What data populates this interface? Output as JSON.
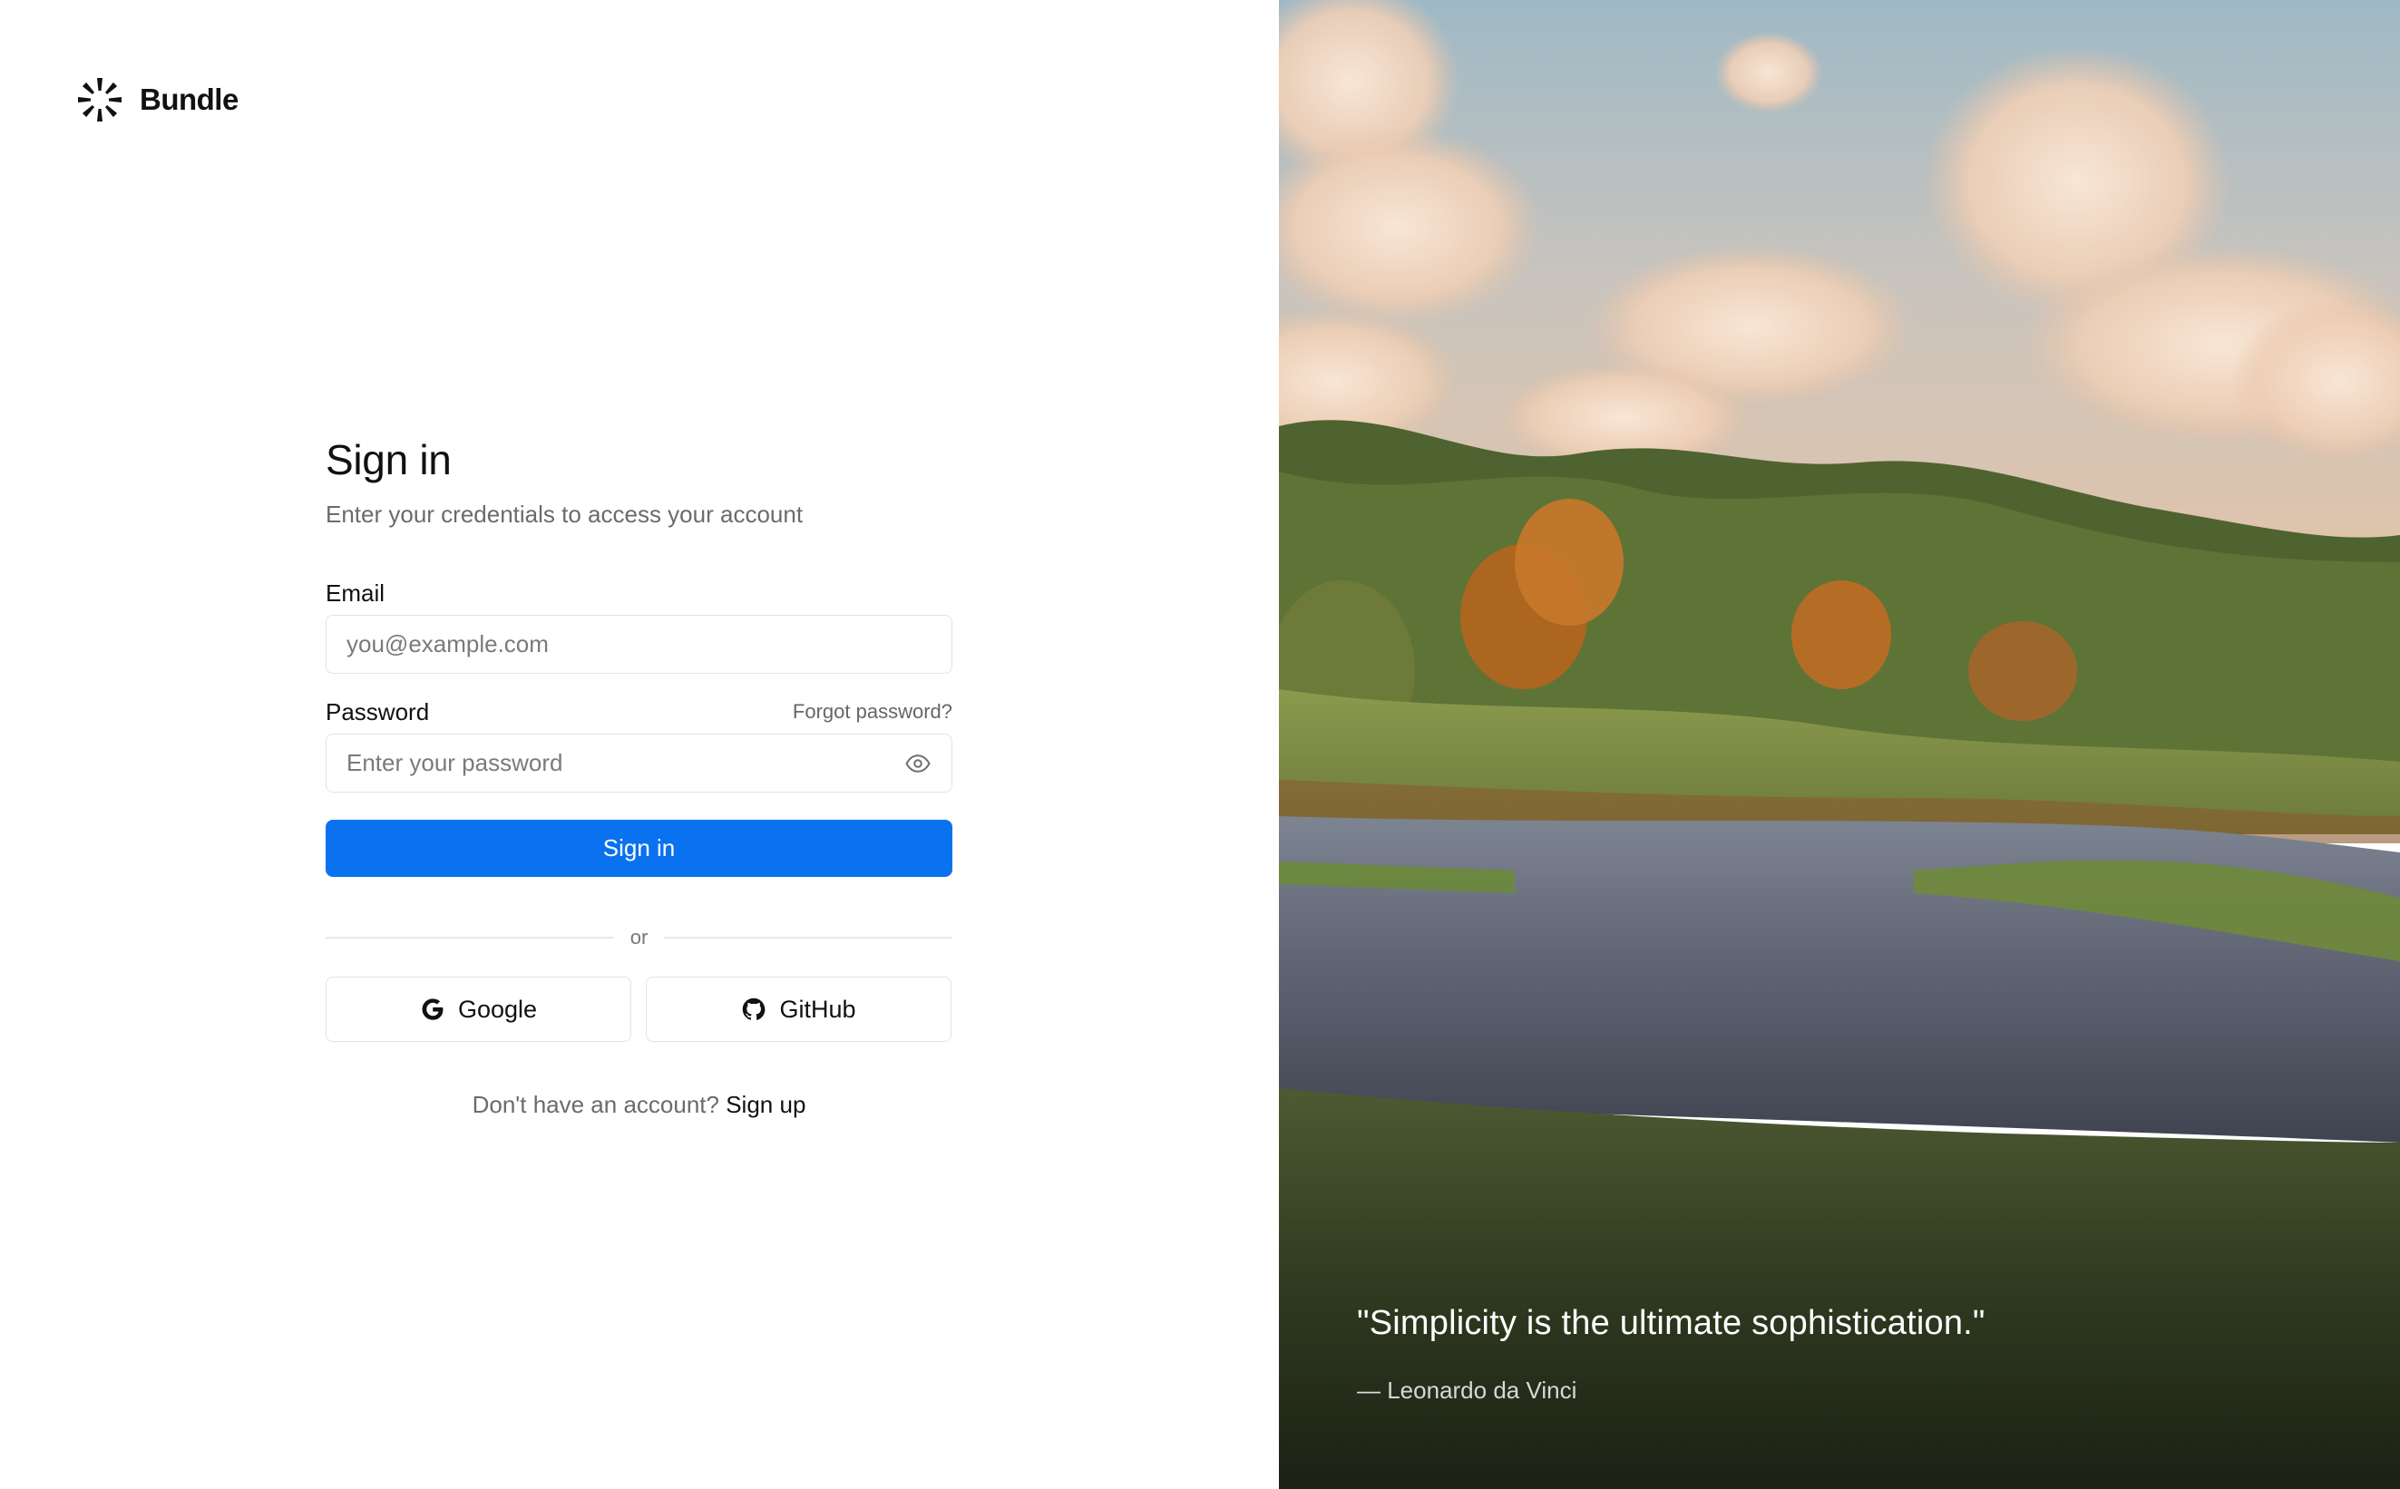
{
  "brand": {
    "name": "Bundle",
    "logo_icon": "starburst-logo-icon"
  },
  "form": {
    "title": "Sign in",
    "subtitle": "Enter your credentials to access your account",
    "email": {
      "label": "Email",
      "placeholder": "you@example.com",
      "value": ""
    },
    "password": {
      "label": "Password",
      "placeholder": "Enter your password",
      "value": "",
      "toggle_icon": "eye-icon"
    },
    "forgot_label": "Forgot password?",
    "submit_label": "Sign in",
    "divider_label": "or",
    "social": [
      {
        "label": "Google",
        "icon": "google-icon"
      },
      {
        "label": "GitHub",
        "icon": "github-icon"
      }
    ],
    "signup_prompt": "Don't have an account?",
    "signup_label": "Sign up"
  },
  "hero": {
    "quote": "\"Simplicity is the ultimate sophistication.\"",
    "author": "— Leonardo da Vinci"
  },
  "colors": {
    "accent": "#0a72ef",
    "border": "#e3e3e3",
    "muted_text": "#6b6b6b"
  }
}
